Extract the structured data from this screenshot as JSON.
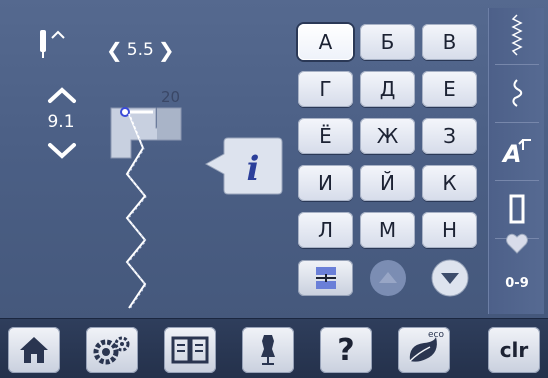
{
  "stitch": {
    "width_value": "5.5",
    "length_value": "9.1",
    "pattern_number": "20"
  },
  "letters": {
    "row1": [
      "А",
      "Б",
      "В"
    ],
    "row2": [
      "Г",
      "Д",
      "Е"
    ],
    "row3": [
      "Ё",
      "Ж",
      "З"
    ],
    "row4": [
      "И",
      "Й",
      "К"
    ],
    "row5": [
      "Л",
      "М",
      "Н"
    ]
  },
  "selected_letter": "А",
  "right_bar": {
    "numbers_label": "0-9"
  },
  "bottom_bar": {
    "help_label": "?",
    "eco_label": "eco",
    "clear_label": "clr"
  },
  "icons": {
    "needle": "needle-position-icon",
    "info": "info-icon",
    "home": "home-icon",
    "setup": "gears-icon",
    "tutorial": "book-icon",
    "dressform": "dress-form-icon",
    "eco": "eco-icon"
  }
}
